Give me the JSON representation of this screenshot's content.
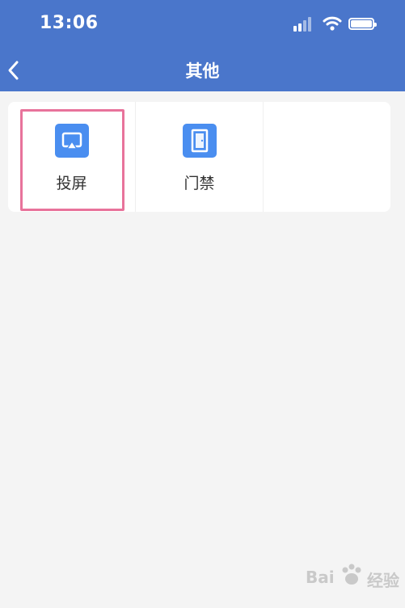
{
  "status_bar": {
    "time": "13:06",
    "icons": [
      "signal-icon",
      "wifi-icon",
      "battery-icon"
    ]
  },
  "nav": {
    "title": "其他",
    "back_icon": "chevron-left-icon"
  },
  "grid": {
    "items": [
      {
        "label": "投屏",
        "icon": "screen-mirror-icon",
        "highlighted": true
      },
      {
        "label": "门禁",
        "icon": "door-icon",
        "highlighted": false
      },
      {
        "label": "",
        "icon": "",
        "highlighted": false
      }
    ]
  },
  "watermark": {
    "left": "Bai",
    "right": "经验"
  },
  "colors": {
    "header": "#4a76cb",
    "icon_tile": "#4a8ef0",
    "highlight_border": "#e8739b",
    "background": "#f4f4f4"
  }
}
